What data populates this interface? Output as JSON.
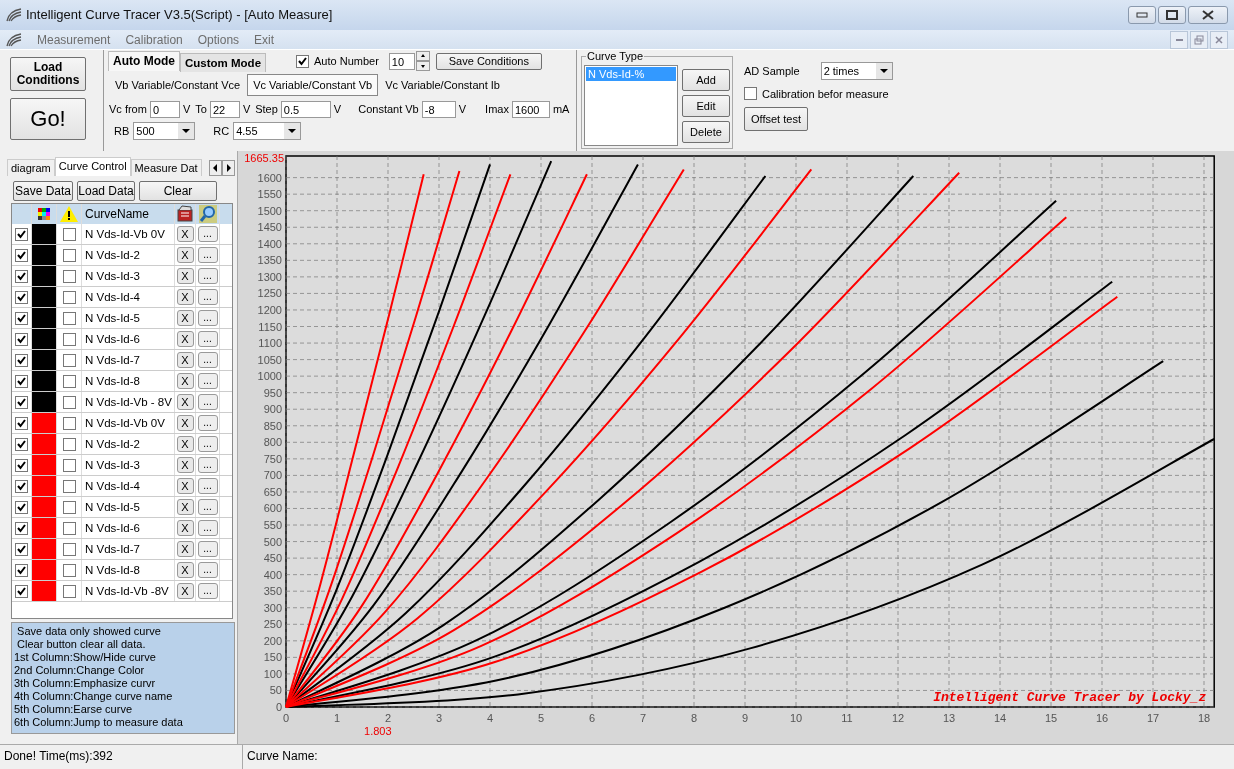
{
  "window": {
    "title": "Intelligent Curve Tracer V3.5(Script) - [Auto Measure]"
  },
  "menu": [
    "Measurement",
    "Calibration",
    "Options",
    "Exit"
  ],
  "toolbar": {
    "load_conditions": "Load Conditions",
    "go": "Go!",
    "mode_tabs": [
      {
        "label": "Auto Mode",
        "selected": true
      },
      {
        "label": "Custom Mode",
        "selected": false
      }
    ],
    "auto_number": {
      "label": "Auto Number",
      "checked": true,
      "value": "10"
    },
    "save_conditions": "Save Conditions",
    "sweep_tabs": [
      {
        "label": "Vb Variable/Constant Vce",
        "selected": false
      },
      {
        "label": "Vc Variable/Constant Vb",
        "selected": true
      },
      {
        "label": "Vc Variable/Constant Ib",
        "selected": false
      }
    ],
    "params": [
      {
        "label": "Vc from",
        "value": "0",
        "unit": "V"
      },
      {
        "label": "To",
        "value": "22",
        "unit": "V"
      },
      {
        "label": "Step",
        "value": "0.5",
        "unit": "V"
      },
      {
        "label": "Constant Vb",
        "value": "-8",
        "unit": "V"
      },
      {
        "label": "Imax",
        "value": "1600",
        "unit": "mA"
      }
    ],
    "dropdowns": [
      {
        "label": "RB",
        "value": "500"
      },
      {
        "label": "RC",
        "value": "4.55"
      }
    ]
  },
  "curve_type": {
    "title": "Curve Type",
    "items": [
      {
        "label": "N Vds-Id-%",
        "selected": true
      }
    ],
    "buttons": [
      "Add",
      "Edit",
      "Delete"
    ]
  },
  "ad_sample": {
    "label": "AD Sample",
    "value": "2 times",
    "calibration": {
      "label": "Calibration befor measure",
      "checked": false
    },
    "offset_test": "Offset test"
  },
  "left_tabs": [
    {
      "label": "diagram",
      "selected": false
    },
    {
      "label": "Curve Control",
      "selected": true
    },
    {
      "label": "Measure Dat",
      "selected": false
    }
  ],
  "left_buttons": [
    "Save Data",
    "Load Data",
    "Clear"
  ],
  "table": {
    "name_column": "CurveName",
    "rows": [
      {
        "shown": true,
        "color": "#000000",
        "emphasized": false,
        "name": "N Vds-Id-Vb 0V",
        "erase": "X",
        "jump": "..."
      },
      {
        "shown": true,
        "color": "#000000",
        "emphasized": false,
        "name": "N Vds-Id-2",
        "erase": "X",
        "jump": "..."
      },
      {
        "shown": true,
        "color": "#000000",
        "emphasized": false,
        "name": "N Vds-Id-3",
        "erase": "X",
        "jump": "..."
      },
      {
        "shown": true,
        "color": "#000000",
        "emphasized": false,
        "name": "N Vds-Id-4",
        "erase": "X",
        "jump": "..."
      },
      {
        "shown": true,
        "color": "#000000",
        "emphasized": false,
        "name": "N Vds-Id-5",
        "erase": "X",
        "jump": "..."
      },
      {
        "shown": true,
        "color": "#000000",
        "emphasized": false,
        "name": "N Vds-Id-6",
        "erase": "X",
        "jump": "..."
      },
      {
        "shown": true,
        "color": "#000000",
        "emphasized": false,
        "name": "N Vds-Id-7",
        "erase": "X",
        "jump": "..."
      },
      {
        "shown": true,
        "color": "#000000",
        "emphasized": false,
        "name": "N Vds-Id-8",
        "erase": "X",
        "jump": "..."
      },
      {
        "shown": true,
        "color": "#000000",
        "emphasized": false,
        "name": "N Vds-Id-Vb - 8V",
        "erase": "X",
        "jump": "..."
      },
      {
        "shown": true,
        "color": "#ff0000",
        "emphasized": false,
        "name": "N Vds-Id-Vb 0V",
        "erase": "X",
        "jump": "..."
      },
      {
        "shown": true,
        "color": "#ff0000",
        "emphasized": false,
        "name": "N Vds-Id-2",
        "erase": "X",
        "jump": "..."
      },
      {
        "shown": true,
        "color": "#ff0000",
        "emphasized": false,
        "name": "N Vds-Id-3",
        "erase": "X",
        "jump": "..."
      },
      {
        "shown": true,
        "color": "#ff0000",
        "emphasized": false,
        "name": "N Vds-Id-4",
        "erase": "X",
        "jump": "..."
      },
      {
        "shown": true,
        "color": "#ff0000",
        "emphasized": false,
        "name": "N Vds-Id-5",
        "erase": "X",
        "jump": "..."
      },
      {
        "shown": true,
        "color": "#ff0000",
        "emphasized": false,
        "name": "N Vds-Id-6",
        "erase": "X",
        "jump": "..."
      },
      {
        "shown": true,
        "color": "#ff0000",
        "emphasized": false,
        "name": "N Vds-Id-7",
        "erase": "X",
        "jump": "..."
      },
      {
        "shown": true,
        "color": "#ff0000",
        "emphasized": false,
        "name": "N Vds-Id-8",
        "erase": "X",
        "jump": "..."
      },
      {
        "shown": true,
        "color": "#ff0000",
        "emphasized": false,
        "name": "N Vds-Id-Vb -8V",
        "erase": "X",
        "jump": "..."
      }
    ]
  },
  "help_lines": [
    " Save data only showed curve",
    " Clear button clear all data.",
    "1st Column:Show/Hide curve",
    "2nd Column:Change Color",
    "3th Column:Emphasize curvr",
    "4th Column:Change curve name",
    "5th Column:Earse curve",
    "6th Column:Jump to measure data"
  ],
  "chart": {
    "chart_data": {
      "type": "line",
      "xlim": [
        0,
        18.2
      ],
      "ylim": [
        0,
        1665.35
      ],
      "xticks": [
        0,
        1,
        2,
        3,
        4,
        5,
        6,
        7,
        8,
        9,
        10,
        11,
        12,
        13,
        14,
        15,
        16,
        17,
        18
      ],
      "yticks": [
        0,
        50,
        100,
        150,
        200,
        250,
        300,
        350,
        400,
        450,
        500,
        550,
        600,
        650,
        700,
        750,
        800,
        850,
        900,
        950,
        1000,
        1050,
        1100,
        1150,
        1200,
        1250,
        1300,
        1350,
        1400,
        1450,
        1500,
        1550,
        1600
      ],
      "series": [
        {
          "color": "#000000",
          "x": [
            0,
            1,
            2,
            3,
            4
          ],
          "values": [
            0,
            358,
            766,
            1196,
            1640
          ]
        },
        {
          "color": "#000000",
          "x": [
            0,
            1.3,
            2.6,
            3.9,
            5.2
          ],
          "values": [
            0,
            335,
            744,
            1185,
            1650
          ]
        },
        {
          "color": "#000000",
          "x": [
            0,
            1.73,
            3.45,
            5.18,
            6.9
          ],
          "values": [
            0,
            310,
            713,
            1161,
            1640
          ]
        },
        {
          "color": "#000000",
          "x": [
            0,
            2.35,
            4.7,
            7.05,
            9.4
          ],
          "values": [
            0,
            284,
            674,
            1120,
            1605
          ]
        },
        {
          "color": "#000000",
          "x": [
            0,
            3.08,
            6.15,
            9.23,
            12.3
          ],
          "values": [
            0,
            247,
            629,
            1088,
            1605
          ]
        },
        {
          "color": "#000000",
          "x": [
            0,
            3.78,
            7.55,
            11.33,
            15.1
          ],
          "values": [
            0,
            205,
            560,
            1008,
            1530
          ]
        },
        {
          "color": "#000000",
          "x": [
            0,
            4.05,
            8.1,
            12.15,
            16.2
          ],
          "values": [
            0,
            150,
            439,
            822,
            1285
          ]
        },
        {
          "color": "#000000",
          "x": [
            0,
            4.3,
            8.6,
            12.9,
            17.2
          ],
          "values": [
            0,
            86,
            300,
            623,
            1045
          ]
        },
        {
          "color": "#000000",
          "x": [
            0,
            4.55,
            9.1,
            13.65,
            18.2
          ],
          "values": [
            0,
            38,
            177,
            430,
            810
          ]
        },
        {
          "color": "#ff0000",
          "x": [
            0,
            0.68,
            1.35,
            2.03,
            2.7
          ],
          "values": [
            0,
            375,
            778,
            1190,
            1610
          ]
        },
        {
          "color": "#ff0000",
          "x": [
            0,
            0.85,
            1.7,
            2.55,
            3.4
          ],
          "values": [
            0,
            353,
            757,
            1181,
            1620
          ]
        },
        {
          "color": "#ff0000",
          "x": [
            0,
            1.1,
            2.2,
            3.3,
            4.4
          ],
          "values": [
            0,
            327,
            726,
            1156,
            1610
          ]
        },
        {
          "color": "#ff0000",
          "x": [
            0,
            1.48,
            2.95,
            4.43,
            5.9
          ],
          "values": [
            0,
            304,
            700,
            1140,
            1610
          ]
        },
        {
          "color": "#ff0000",
          "x": [
            0,
            1.95,
            3.9,
            5.85,
            7.8
          ],
          "values": [
            0,
            288,
            683,
            1134,
            1625
          ]
        },
        {
          "color": "#ff0000",
          "x": [
            0,
            2.58,
            5.15,
            7.73,
            10.3
          ],
          "values": [
            0,
            268,
            660,
            1118,
            1625
          ]
        },
        {
          "color": "#ff0000",
          "x": [
            0,
            3.3,
            6.6,
            9.9,
            13.2
          ],
          "values": [
            0,
            233,
            612,
            1079,
            1615
          ]
        },
        {
          "color": "#ff0000",
          "x": [
            0,
            3.83,
            7.65,
            11.48,
            15.3
          ],
          "values": [
            0,
            185,
            524,
            962,
            1480
          ]
        },
        {
          "color": "#ff0000",
          "x": [
            0,
            4.08,
            8.15,
            12.23,
            16.3
          ],
          "values": [
            0,
            135,
            409,
            782,
            1240
          ]
        }
      ],
      "grid": true,
      "annotations": [
        "1665.35",
        "1.803",
        "Intelligent Curve Tracer by Locky_z"
      ]
    }
  },
  "status_bar": {
    "left": "Done!  Time(ms):392",
    "right": "Curve Name:"
  }
}
